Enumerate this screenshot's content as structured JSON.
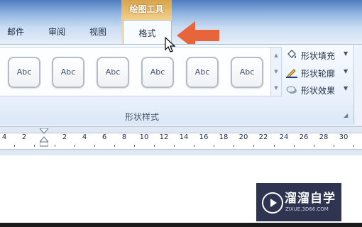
{
  "ribbon_tabs": {
    "mail": "邮件",
    "review": "审阅",
    "view": "视图",
    "format": "格式"
  },
  "contextual_tab_group": "绘图工具",
  "shape_styles": {
    "items": [
      "Abc",
      "Abc",
      "Abc",
      "Abc",
      "Abc",
      "Abc"
    ],
    "group_label": "形状样式"
  },
  "shape_commands": {
    "fill": "形状填充",
    "outline": "形状轮廓",
    "effects": "形状效果"
  },
  "ruler": {
    "labels": [
      "4",
      "2",
      "2",
      "4",
      "6",
      "8",
      "10",
      "12",
      "14",
      "16",
      "18",
      "20",
      "22",
      "24",
      "26",
      "28",
      "30"
    ]
  },
  "watermark": {
    "title": "溜溜自学",
    "url": "ZIXUE.3D66.COM"
  },
  "colors": {
    "accent_arrow": "#e8643a",
    "contextual_tab": "#e2b15a",
    "ribbon_blue": "#dbe7f6"
  }
}
